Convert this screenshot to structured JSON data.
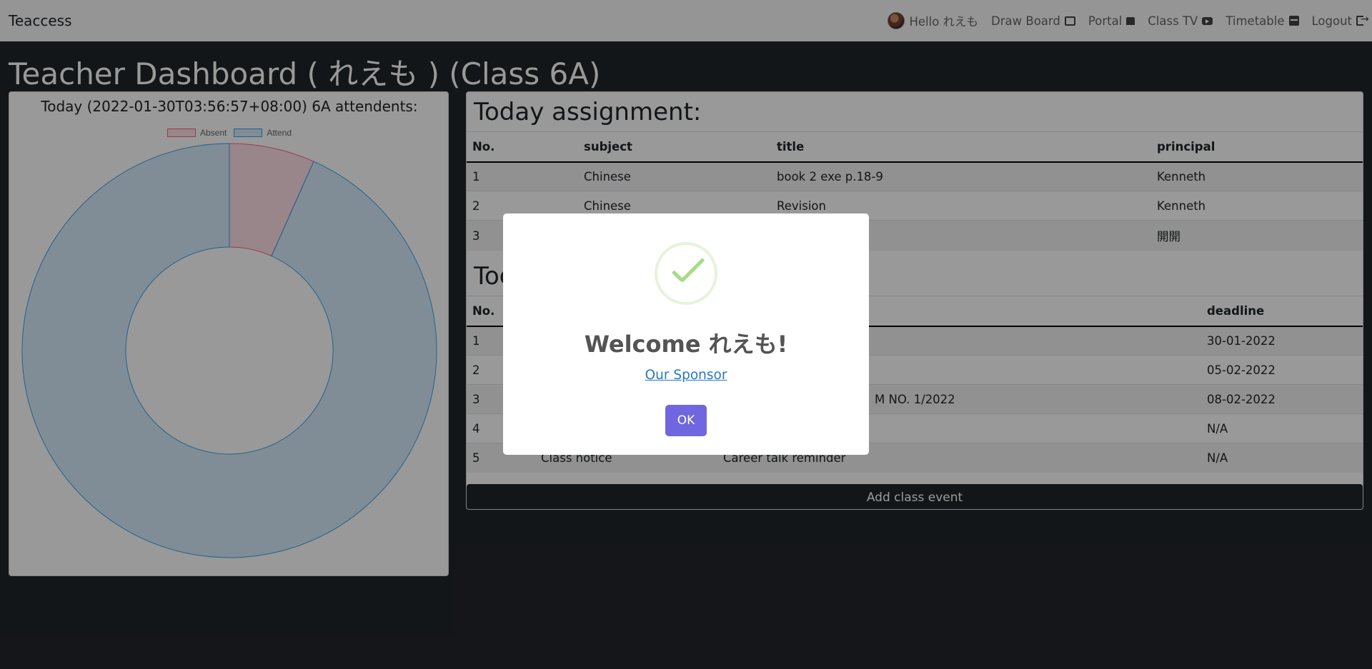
{
  "navbar": {
    "brand": "Teaccess",
    "items": [
      {
        "label": "Hello れえも",
        "icon": "avatar"
      },
      {
        "label": "Draw Board",
        "icon": "laptop-icon"
      },
      {
        "label": "Portal",
        "icon": "portal-icon"
      },
      {
        "label": "Class TV",
        "icon": "tv-play-icon"
      },
      {
        "label": "Timetable",
        "icon": "calendar-icon"
      },
      {
        "label": "Logout",
        "icon": "logout-icon"
      }
    ]
  },
  "page": {
    "title": "Teacher Dashboard ( れえも ) (Class 6A)"
  },
  "attendance": {
    "title": "Today (2022-01-30T03:56:57+08:00) 6A attendents:"
  },
  "chart_data": {
    "type": "doughnut",
    "categories": [
      "Absent",
      "Attend"
    ],
    "values": [
      2,
      28
    ],
    "legend": "top",
    "colors": {
      "Absent": "#ff6384",
      "Attend": "#36a2eb"
    }
  },
  "assignments": {
    "title": "Today assignment:",
    "headers": [
      "No.",
      "subject",
      "title",
      "principal"
    ],
    "rows": [
      [
        "1",
        "Chinese",
        "book 2 exe p.18-9",
        "Kenneth"
      ],
      [
        "2",
        "Chinese",
        "Revision",
        "Kenneth"
      ],
      [
        "3",
        "",
        "",
        "開開"
      ]
    ]
  },
  "events": {
    "title_partial": "Tod",
    "headers": [
      "No.",
      "",
      "",
      "deadline"
    ],
    "rows": [
      [
        "1",
        "",
        "",
        "30-01-2022"
      ],
      [
        "2",
        "",
        "",
        "05-02-2022"
      ],
      [
        "3",
        "",
        "M NO. 1/2022",
        "08-02-2022"
      ],
      [
        "4",
        "",
        "",
        "N/A"
      ],
      [
        "5",
        "Class notice",
        "Career talk reminder",
        "N/A"
      ]
    ],
    "add_button": "Add class event"
  },
  "modal": {
    "title": "Welcome れえも!",
    "link": "Our Sponsor",
    "button": "OK",
    "icon": "success-check-icon"
  }
}
